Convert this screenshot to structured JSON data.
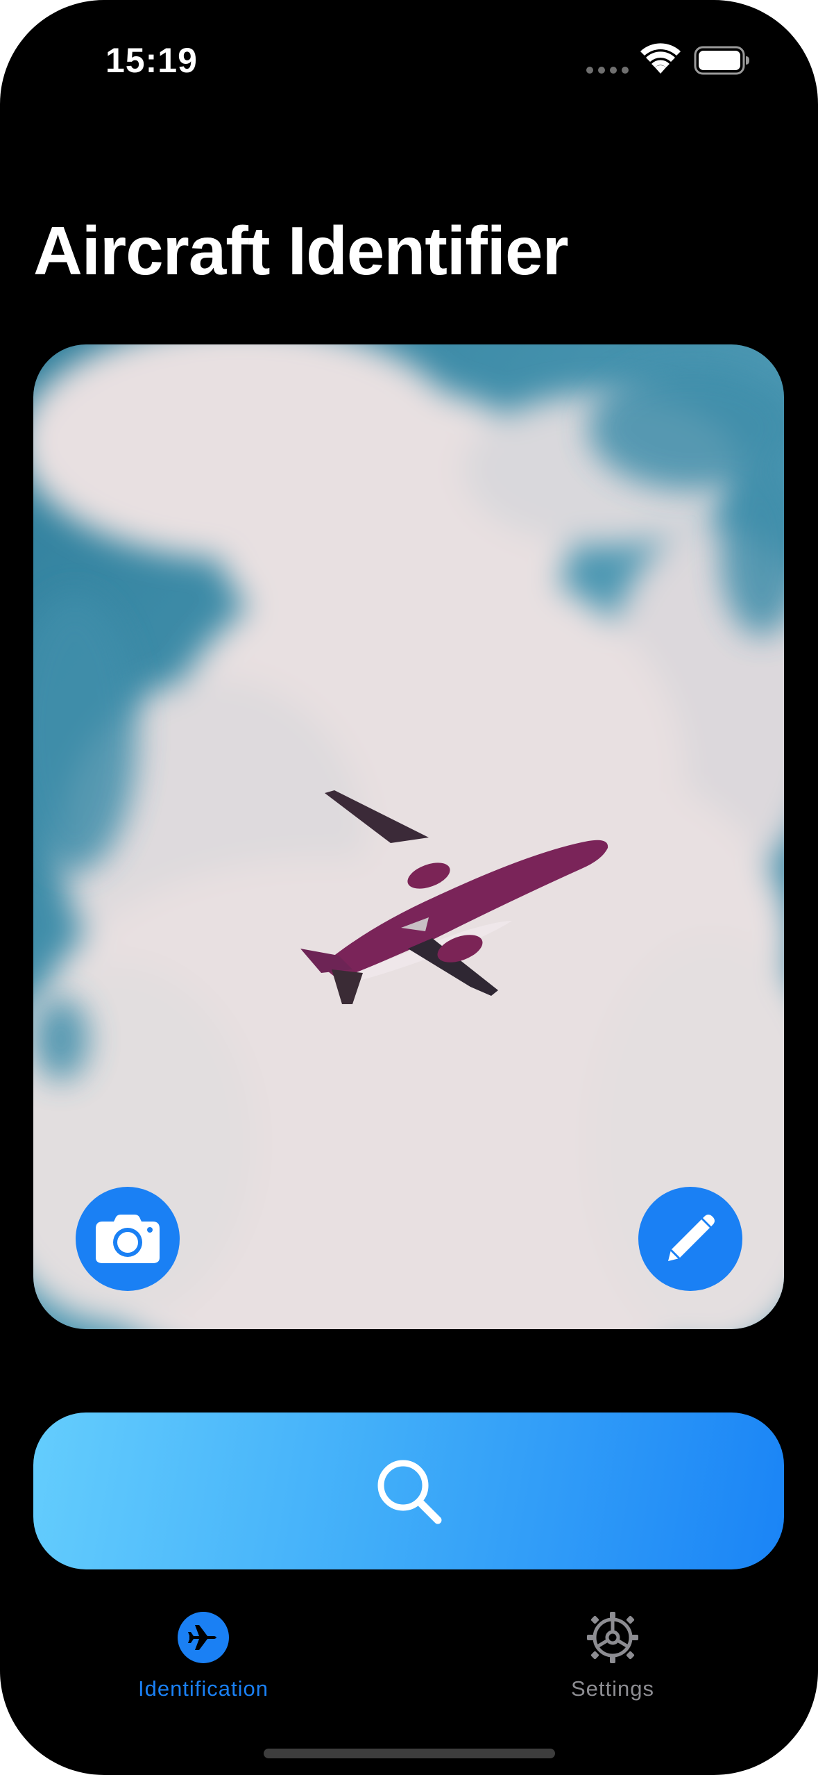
{
  "status_bar": {
    "time": "15:19",
    "icons": [
      "cellular-dots-icon",
      "wifi-icon",
      "battery-icon"
    ]
  },
  "header": {
    "title": "Aircraft Identifier"
  },
  "photo_card": {
    "image": "airplane-in-cloudy-sky",
    "camera_button_icon": "camera-icon",
    "edit_button_icon": "pencil-icon"
  },
  "identify_button": {
    "icon": "magnifying-glass-icon"
  },
  "tab_bar": {
    "tabs": [
      {
        "label": "Identification",
        "icon": "airplane-circle-icon",
        "selected": true
      },
      {
        "label": "Settings",
        "icon": "gear-icon",
        "selected": false
      }
    ]
  },
  "colors": {
    "background": "#000000",
    "accent": "#1a80f4",
    "gradient_start": "#64cdfd",
    "gradient_end": "#1a84f6",
    "inactive_tab": "#8d8d92"
  }
}
